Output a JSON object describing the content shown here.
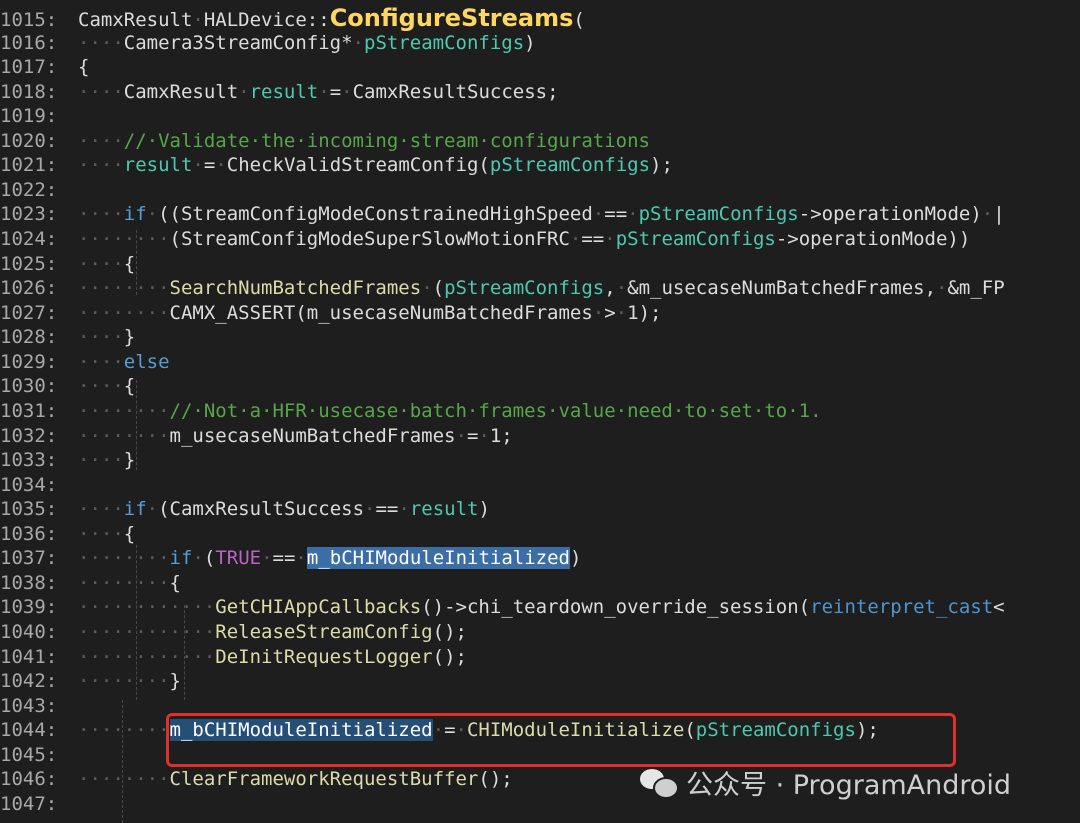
{
  "code_view": {
    "lines": [
      {
        "num": "1015:",
        "segments": [
          [
            "txt",
            "CamxResult"
          ],
          [
            "ws",
            "·"
          ],
          [
            "txt",
            "HALDevice::"
          ],
          [
            "fnb",
            "ConfigureStreams"
          ],
          [
            "txt",
            "("
          ]
        ]
      },
      {
        "num": "1016:",
        "segments": [
          [
            "ws",
            "····"
          ],
          [
            "txt",
            "Camera3StreamConfig*"
          ],
          [
            "ws",
            "·"
          ],
          [
            "var",
            "pStreamConfigs"
          ],
          [
            "txt",
            ")"
          ]
        ]
      },
      {
        "num": "1017:",
        "segments": [
          [
            "txt",
            "{"
          ]
        ]
      },
      {
        "num": "1018:",
        "segments": [
          [
            "ws",
            "····"
          ],
          [
            "txt",
            "CamxResult"
          ],
          [
            "ws",
            "·"
          ],
          [
            "var",
            "result"
          ],
          [
            "ws",
            "·"
          ],
          [
            "txt",
            "="
          ],
          [
            "ws",
            "·"
          ],
          [
            "txt",
            "CamxResultSuccess;"
          ]
        ]
      },
      {
        "num": "1019:",
        "segments": []
      },
      {
        "num": "1020:",
        "segments": [
          [
            "ws",
            "····"
          ],
          [
            "cm",
            "//·Validate·the·incoming·stream·configurations"
          ]
        ]
      },
      {
        "num": "1021:",
        "segments": [
          [
            "ws",
            "····"
          ],
          [
            "var",
            "result"
          ],
          [
            "ws",
            "·"
          ],
          [
            "txt",
            "="
          ],
          [
            "ws",
            "·"
          ],
          [
            "txt",
            "CheckValidStreamConfig("
          ],
          [
            "var",
            "pStreamConfigs"
          ],
          [
            "txt",
            ");"
          ]
        ]
      },
      {
        "num": "1022:",
        "segments": []
      },
      {
        "num": "1023:",
        "segments": [
          [
            "ws",
            "····"
          ],
          [
            "kw",
            "if"
          ],
          [
            "ws",
            "·"
          ],
          [
            "txt",
            "((StreamConfigModeConstrainedHighSpeed"
          ],
          [
            "ws",
            "·"
          ],
          [
            "txt",
            "=="
          ],
          [
            "ws",
            "·"
          ],
          [
            "var",
            "pStreamConfigs"
          ],
          [
            "txt",
            "->operationMode)"
          ],
          [
            "ws",
            "·"
          ],
          [
            "txt",
            "|"
          ]
        ]
      },
      {
        "num": "1024:",
        "segments": [
          [
            "ws",
            "········"
          ],
          [
            "txt",
            "(StreamConfigModeSuperSlowMotionFRC"
          ],
          [
            "ws",
            "·"
          ],
          [
            "txt",
            "=="
          ],
          [
            "ws",
            "·"
          ],
          [
            "var",
            "pStreamConfigs"
          ],
          [
            "txt",
            "->operationMode))"
          ]
        ]
      },
      {
        "num": "1025:",
        "segments": [
          [
            "ws",
            "····"
          ],
          [
            "txt",
            "{"
          ]
        ]
      },
      {
        "num": "1026:",
        "segments": [
          [
            "ws",
            "········"
          ],
          [
            "fn",
            "SearchNumBatchedFrames"
          ],
          [
            "ws",
            "·"
          ],
          [
            "txt",
            "("
          ],
          [
            "var",
            "pStreamConfigs"
          ],
          [
            "txt",
            ","
          ],
          [
            "ws",
            "·"
          ],
          [
            "txt",
            "&m_usecaseNumBatchedFrames,"
          ],
          [
            "ws",
            "·"
          ],
          [
            "txt",
            "&m_FP"
          ]
        ]
      },
      {
        "num": "1027:",
        "segments": [
          [
            "ws",
            "········"
          ],
          [
            "txt",
            "CAMX_ASSERT(m_usecaseNumBatchedFrames"
          ],
          [
            "ws",
            "·"
          ],
          [
            "txt",
            ">"
          ],
          [
            "ws",
            "·"
          ],
          [
            "txt",
            "1);"
          ]
        ]
      },
      {
        "num": "1028:",
        "segments": [
          [
            "ws",
            "····"
          ],
          [
            "txt",
            "}"
          ]
        ]
      },
      {
        "num": "1029:",
        "segments": [
          [
            "ws",
            "····"
          ],
          [
            "kw",
            "else"
          ]
        ]
      },
      {
        "num": "1030:",
        "segments": [
          [
            "ws",
            "····"
          ],
          [
            "txt",
            "{"
          ]
        ]
      },
      {
        "num": "1031:",
        "segments": [
          [
            "ws",
            "········"
          ],
          [
            "cm",
            "//·Not·a·HFR·usecase·batch·frames·value·need·to·set·to·1."
          ]
        ]
      },
      {
        "num": "1032:",
        "segments": [
          [
            "ws",
            "········"
          ],
          [
            "txt",
            "m_usecaseNumBatchedFrames"
          ],
          [
            "ws",
            "·"
          ],
          [
            "txt",
            "="
          ],
          [
            "ws",
            "·"
          ],
          [
            "txt",
            "1;"
          ]
        ]
      },
      {
        "num": "1033:",
        "segments": [
          [
            "ws",
            "····"
          ],
          [
            "txt",
            "}"
          ]
        ]
      },
      {
        "num": "1034:",
        "segments": []
      },
      {
        "num": "1035:",
        "segments": [
          [
            "ws",
            "····"
          ],
          [
            "kw",
            "if"
          ],
          [
            "ws",
            "·"
          ],
          [
            "txt",
            "(CamxResultSuccess"
          ],
          [
            "ws",
            "·"
          ],
          [
            "txt",
            "=="
          ],
          [
            "ws",
            "·"
          ],
          [
            "var",
            "result"
          ],
          [
            "txt",
            ")"
          ]
        ]
      },
      {
        "num": "1036:",
        "segments": [
          [
            "ws",
            "····"
          ],
          [
            "txt",
            "{"
          ]
        ]
      },
      {
        "num": "1037:",
        "segments": [
          [
            "ws",
            "········"
          ],
          [
            "kw",
            "if"
          ],
          [
            "ws",
            "·"
          ],
          [
            "txt",
            "("
          ],
          [
            "mac",
            "TRUE"
          ],
          [
            "ws",
            "·"
          ],
          [
            "txt",
            "=="
          ],
          [
            "ws",
            "·"
          ],
          [
            "hl-soft",
            "m_bCHIModuleInitialized"
          ],
          [
            "txt",
            ")"
          ]
        ]
      },
      {
        "num": "1038:",
        "segments": [
          [
            "ws",
            "········"
          ],
          [
            "txt",
            "{"
          ]
        ]
      },
      {
        "num": "1039:",
        "segments": [
          [
            "ws",
            "············"
          ],
          [
            "fn",
            "GetCHIAppCallbacks"
          ],
          [
            "txt",
            "()->chi_teardown_override_session("
          ],
          [
            "rc",
            "reinterpret_cast"
          ],
          [
            "txt",
            "<"
          ]
        ]
      },
      {
        "num": "1040:",
        "segments": [
          [
            "ws",
            "············"
          ],
          [
            "fn",
            "ReleaseStreamConfig"
          ],
          [
            "txt",
            "();"
          ]
        ]
      },
      {
        "num": "1041:",
        "segments": [
          [
            "ws",
            "············"
          ],
          [
            "fn",
            "DeInitRequestLogger"
          ],
          [
            "txt",
            "();"
          ]
        ]
      },
      {
        "num": "1042:",
        "segments": [
          [
            "ws",
            "········"
          ],
          [
            "txt",
            "}"
          ]
        ]
      },
      {
        "num": "1043:",
        "segments": []
      },
      {
        "num": "1044:",
        "segments": [
          [
            "ws",
            "········"
          ],
          [
            "hl",
            "m_bCHIModuleInitialized"
          ],
          [
            "ws",
            "·"
          ],
          [
            "txt",
            "="
          ],
          [
            "ws",
            "·"
          ],
          [
            "fn",
            "CHIModuleInitialize"
          ],
          [
            "txt",
            "("
          ],
          [
            "var",
            "pStreamConfigs"
          ],
          [
            "txt",
            ");"
          ]
        ]
      },
      {
        "num": "1045:",
        "segments": []
      },
      {
        "num": "1046:",
        "segments": [
          [
            "ws",
            "········"
          ],
          [
            "fn",
            "ClearFrameworkRequestBuffer"
          ],
          [
            "txt",
            "();"
          ]
        ]
      },
      {
        "num": "1047:",
        "segments": []
      }
    ]
  },
  "watermark": {
    "icon": "wechat-icon",
    "text": "公众号 · ProgramAndroid"
  },
  "colors": {
    "background": "#1e1e1e",
    "highlight_box": "#e0302a",
    "selection": "#264f78"
  }
}
